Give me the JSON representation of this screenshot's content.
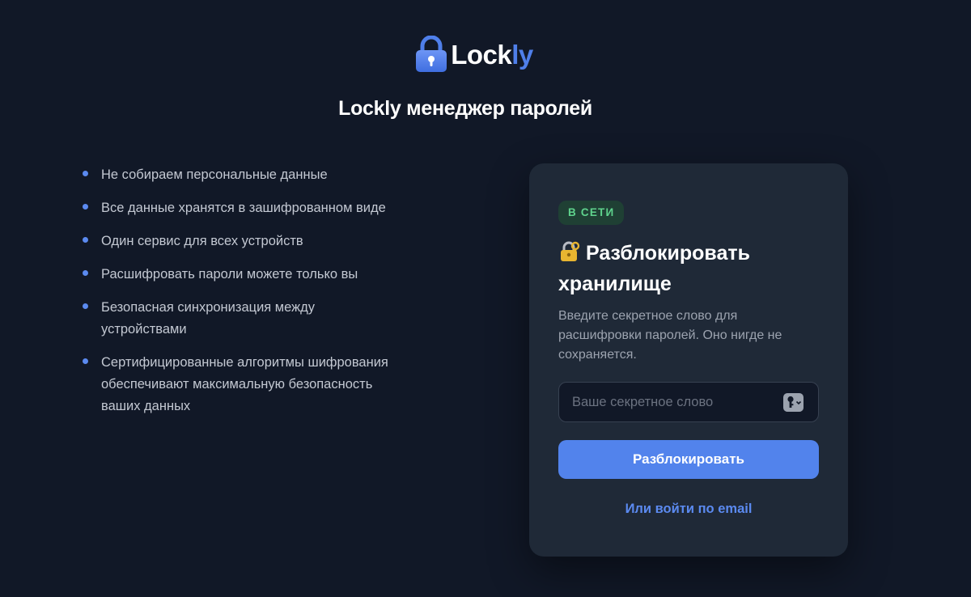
{
  "app": {
    "logo_text_a": "Lock",
    "logo_text_b": "ly",
    "title": "Lockly менеджер паролей"
  },
  "features": [
    "Не собираем персональные данные",
    "Все данные хранятся в зашифрованном виде",
    "Один сервис для всех устройств",
    "Расшифровать пароли можете только вы",
    "Безопасная синхронизация между устройствами",
    "Сертифицированные алгоритмы шифрования обеспечивают максимальную безопасность ваших данных"
  ],
  "card": {
    "status_badge": "В СЕТИ",
    "title": "Разблокировать хранилище",
    "description": "Введите секретное слово для расшифровки паролей. Оно нигде не сохраняется.",
    "secret_placeholder": "Ваше секретное слово",
    "secret_value": "",
    "unlock_label": "Разблокировать",
    "email_link": "Или войти по email"
  },
  "icons": {
    "logo": "padlock-icon",
    "title_emoji": "locked-with-key-icon",
    "password_manager": "key-icon"
  },
  "colors": {
    "background": "#111827",
    "card": "#1f2937",
    "accent": "#5283ec",
    "online": "#5fd38d"
  }
}
